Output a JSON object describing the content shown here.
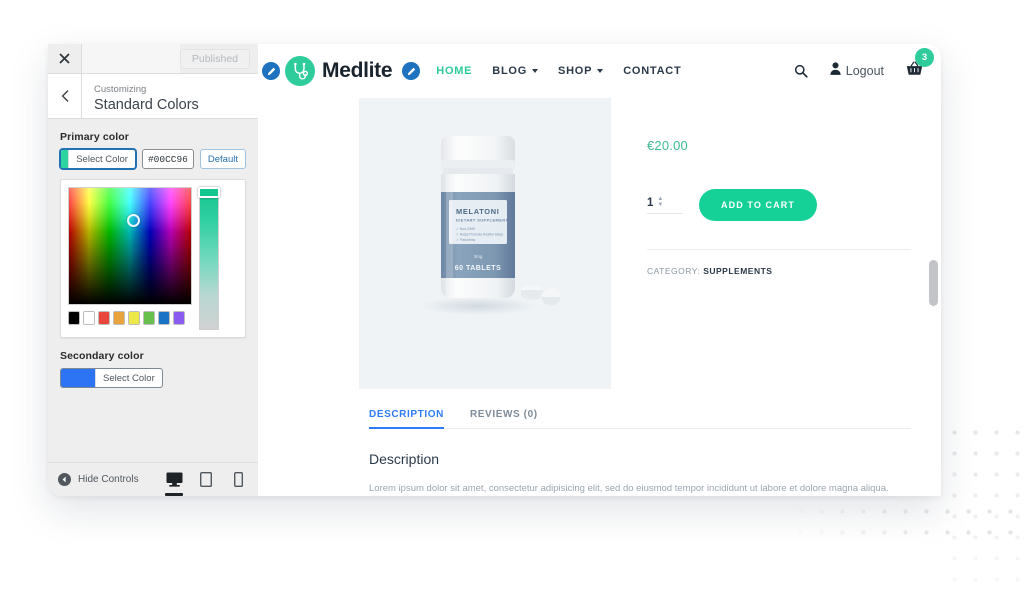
{
  "customizer": {
    "close_icon": "close-icon",
    "publish_label": "Published",
    "back_icon": "chevron-left-icon",
    "kicker": "Customizing",
    "title": "Standard Colors",
    "primary": {
      "label": "Primary color",
      "select_label": "Select Color",
      "hex_value": "#00CC96",
      "default_label": "Default",
      "swatch_color": "#2dd4a0"
    },
    "secondary": {
      "label": "Secondary color",
      "select_label": "Select Color",
      "swatch_color": "#2d74f5"
    },
    "palette": [
      {
        "name": "black",
        "color": "#000000"
      },
      {
        "name": "white",
        "color": "#ffffff"
      },
      {
        "name": "red",
        "color": "#e8453c"
      },
      {
        "name": "orange",
        "color": "#e8a33d"
      },
      {
        "name": "yellow",
        "color": "#ece84a"
      },
      {
        "name": "green",
        "color": "#67c04b"
      },
      {
        "name": "blue",
        "color": "#1a73c4"
      },
      {
        "name": "purple",
        "color": "#8b5cf0"
      }
    ],
    "footer": {
      "hide_controls_label": "Hide Controls",
      "devices": [
        {
          "name": "desktop",
          "active": true
        },
        {
          "name": "tablet",
          "active": false
        },
        {
          "name": "mobile",
          "active": false
        }
      ]
    }
  },
  "site": {
    "brand_name": "Medlite",
    "logo_icon": "stethoscope-icon",
    "nav": [
      {
        "label": "HOME",
        "active": true,
        "dropdown": false
      },
      {
        "label": "BLOG",
        "active": false,
        "dropdown": true
      },
      {
        "label": "SHOP",
        "active": false,
        "dropdown": true
      },
      {
        "label": "CONTACT",
        "active": false,
        "dropdown": false
      }
    ],
    "search_icon": "search-icon",
    "account": {
      "icon": "user-icon",
      "label": "Logout"
    },
    "cart": {
      "icon": "basket-icon",
      "count": "3"
    },
    "product": {
      "price": "€20.00",
      "quantity": "1",
      "add_to_cart_label": "ADD TO CART",
      "category_label": "CATEGORY:",
      "category_value": "SUPPLEMENTS",
      "image": {
        "brand": "MELATONI",
        "subtitle": "DIETARY SUPPLEMENT",
        "bullets": [
          "Non-GMO",
          "Helps Promote Restful Sleep",
          "Flavorless"
        ],
        "dosage": "3mg",
        "count": "60 TABLETS"
      }
    },
    "tabs": [
      {
        "label": "DESCRIPTION",
        "active": true
      },
      {
        "label": "REVIEWS (0)",
        "active": false
      }
    ],
    "description_heading": "Description",
    "description_text": "Lorem ipsum dolor sit amet, consectetur adipisicing elit, sed do eiusmod tempor incididunt ut labore et dolore magna aliqua. Ut enim ad minim"
  },
  "colors": {
    "accent_green": "#2ecc9b",
    "button_green": "#16d197",
    "link_blue": "#2f7df6",
    "wp_blue": "#2271b1",
    "pencil_blue": "#1f73be"
  }
}
